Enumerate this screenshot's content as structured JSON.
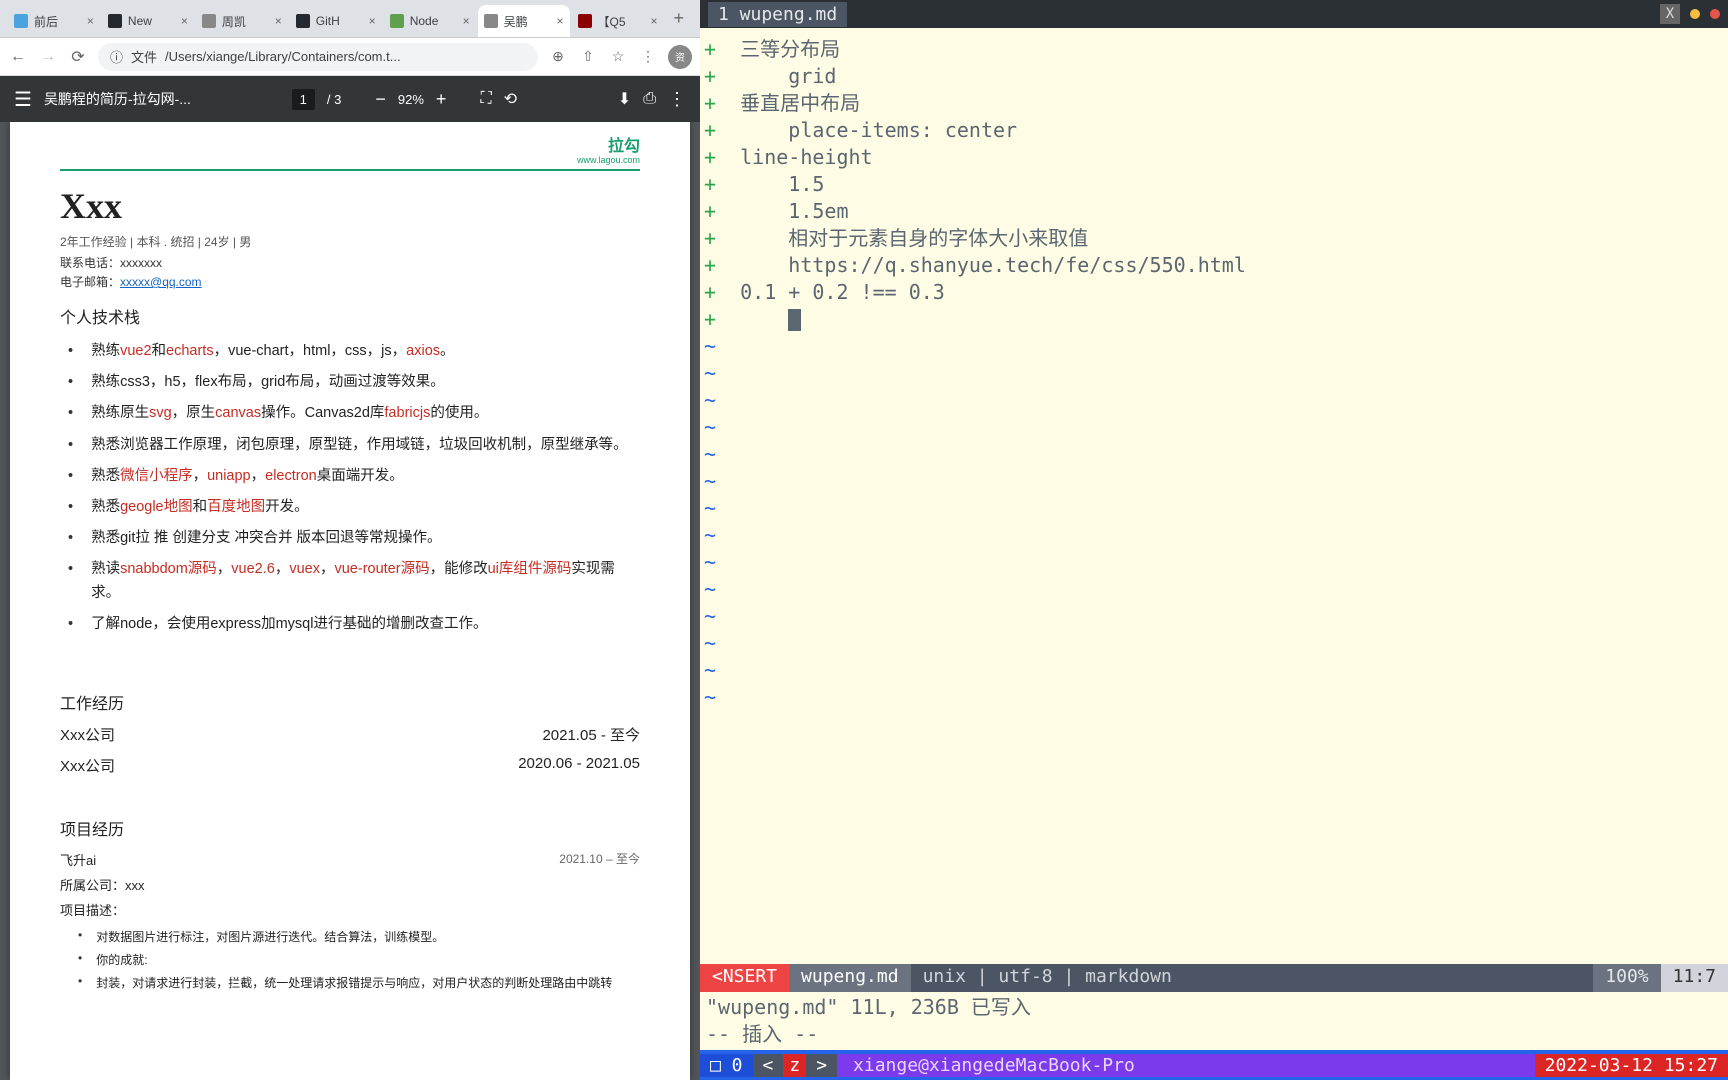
{
  "browser": {
    "tabs": [
      {
        "label": "前后",
        "favicon": "#4aa3df"
      },
      {
        "label": "New",
        "favicon": "#24292f"
      },
      {
        "label": "周凯",
        "favicon": "#888"
      },
      {
        "label": "GitH",
        "favicon": "#24292f"
      },
      {
        "label": "Node",
        "favicon": "#5fa04e"
      },
      {
        "label": "吴鹏",
        "favicon": "#888",
        "active": true
      },
      {
        "label": "【Q5",
        "favicon": "#8b0000"
      }
    ],
    "url_proto": "文件",
    "url_path": "/Users/xiange/Library/Containers/com.t...",
    "profile_letter": "资"
  },
  "pdf": {
    "title": "吴鹏程的简历-拉勾网-...",
    "page": "1",
    "total": "3",
    "zoom": "92%"
  },
  "resume": {
    "logo": "拉勾",
    "logo_sub": "www.lagou.com",
    "name": "Xxx",
    "meta": "2年工作经验 | 本科 . 统招 | 24岁 | 男",
    "phone_label": "联系电话：",
    "phone": "xxxxxxx",
    "email_label": "电子邮箱：",
    "email": "xxxxx@qq.com",
    "stack_h": "个人技术栈",
    "skills": [
      [
        [
          "熟练"
        ],
        [
          "vue2",
          "red"
        ],
        [
          "和"
        ],
        [
          "echarts",
          "red"
        ],
        [
          "，vue-chart，html，css，js，"
        ],
        [
          "axios",
          "red"
        ],
        [
          "。"
        ]
      ],
      [
        [
          "熟练css3，h5，flex布局，grid布局，动画过渡等效果。"
        ]
      ],
      [
        [
          "熟练原生"
        ],
        [
          "svg",
          "red"
        ],
        [
          "，原生"
        ],
        [
          "canvas",
          "red"
        ],
        [
          "操作。Canvas2d库"
        ],
        [
          "fabricjs",
          "red"
        ],
        [
          "的使用。"
        ]
      ],
      [
        [
          "熟悉浏览器工作原理，闭包原理，原型链，作用域链，垃圾回收机制，原型继承等。"
        ]
      ],
      [
        [
          "熟悉"
        ],
        [
          "微信小程序",
          "red"
        ],
        [
          "，"
        ],
        [
          "uniapp",
          "red"
        ],
        [
          "，"
        ],
        [
          "electron",
          "red"
        ],
        [
          "桌面端开发。"
        ]
      ],
      [
        [
          "熟悉"
        ],
        [
          "geogle地图",
          "red"
        ],
        [
          "和"
        ],
        [
          "百度地图",
          "red"
        ],
        [
          "开发。"
        ]
      ],
      [
        [
          "熟悉git拉 推 创建分支  冲突合并 版本回退等常规操作。"
        ]
      ],
      [
        [
          "熟读"
        ],
        [
          "snabbdom源码",
          "red"
        ],
        [
          "，"
        ],
        [
          "vue2.6",
          "red"
        ],
        [
          "，"
        ],
        [
          "vuex",
          "red"
        ],
        [
          "，"
        ],
        [
          "vue-router源码",
          "red"
        ],
        [
          "，能修改"
        ],
        [
          "ui库组件源码",
          "red"
        ],
        [
          "实现需求。"
        ]
      ],
      [
        [
          "了解node，会使用express加mysql进行基础的增删改查工作。"
        ]
      ]
    ],
    "work_h": "工作经历",
    "jobs": [
      {
        "company": "Xxx公司",
        "period": "2021.05 - 至今"
      },
      {
        "company": "Xxx公司",
        "period": "2020.06 - 2021.05"
      }
    ],
    "proj_h": "项目经历",
    "proj_name": "飞升ai",
    "proj_period": "2021.10 – 至今",
    "proj_company_label": "所属公司：",
    "proj_company": "xxx",
    "proj_desc_label": "项目描述：",
    "proj_bullets": [
      "对数据图片进行标注，对图片源进行迭代。结合算法，训练模型。",
      "你的成就:",
      "封装，对请求进行封装，拦截，统一处理请求报错提示与响应，对用户状态的判断处理路由中跳转"
    ]
  },
  "term": {
    "file_tab": "1 wupeng.md",
    "lines": [
      {
        "i": 0,
        "t": "三等分布局"
      },
      {
        "i": 1,
        "t": "grid"
      },
      {
        "i": 0,
        "t": "垂直居中布局"
      },
      {
        "i": 1,
        "t": "place-items: center"
      },
      {
        "i": 0,
        "t": "line-height"
      },
      {
        "i": 1,
        "t": "1.5"
      },
      {
        "i": 1,
        "t": "1.5em"
      },
      {
        "i": 1,
        "t": "相对于元素自身的字体大小来取值"
      },
      {
        "i": 1,
        "t": "https://q.shanyue.tech/fe/css/550.html"
      },
      {
        "i": 0,
        "t": "0.1 + 0.2 !== 0.3"
      },
      {
        "i": 1,
        "t": "",
        "cursor": true
      }
    ],
    "tildes": 14,
    "status": {
      "mode": "<NSERT",
      "file": "wupeng.md",
      "info": "unix | utf-8 | markdown",
      "pct": "100%",
      "pos": "11:7"
    },
    "msg1": "\"wupeng.md\" 11L, 236B 已写入",
    "msg2": "-- 插入 --",
    "tmux": {
      "idx": "□ 0",
      "z_pre": "<",
      "z": "z",
      "z_post": ">",
      "sess": "xiange@xiangedeMacBook-Pro",
      "date": "2022-03-12 15:27"
    }
  }
}
